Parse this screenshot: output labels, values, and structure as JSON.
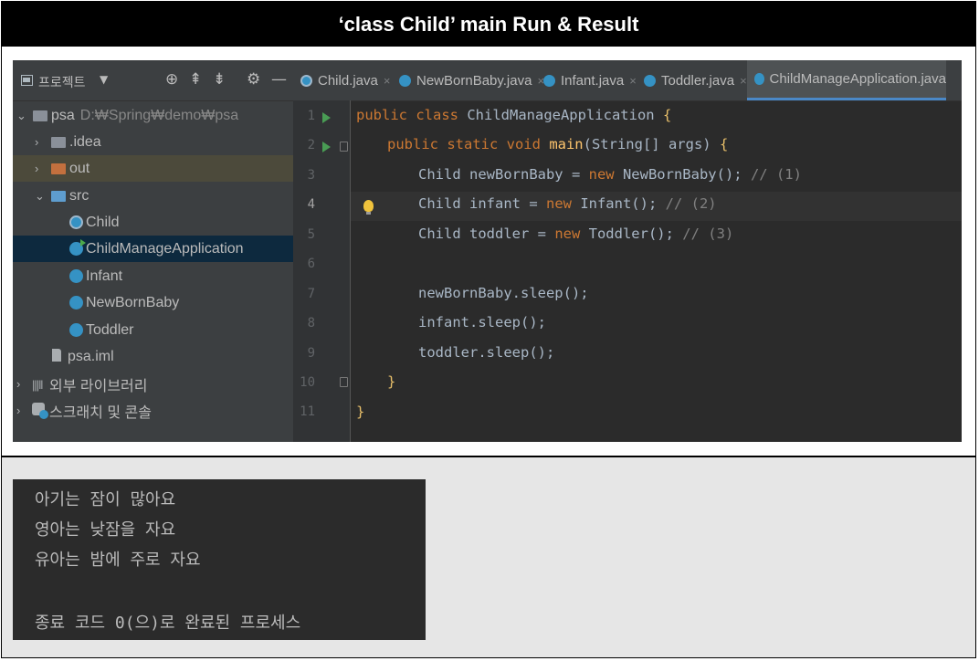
{
  "slide": {
    "title": "‘class Child’ main Run & Result"
  },
  "project_panel": {
    "title": "프로젝트",
    "caret": "▼",
    "tools": [
      "⊕",
      "⇞",
      "⇟",
      "⚙",
      "—"
    ],
    "root": {
      "name": "psa",
      "path": "D:₩Spring₩demo₩psa"
    },
    "items": [
      {
        "label": ".idea"
      },
      {
        "label": "out"
      },
      {
        "label": "src"
      },
      {
        "label": "Child"
      },
      {
        "label": "ChildManageApplication"
      },
      {
        "label": "Infant"
      },
      {
        "label": "NewBornBaby"
      },
      {
        "label": "Toddler"
      },
      {
        "label": "psa.iml"
      },
      {
        "label": "외부 라이브러리"
      },
      {
        "label": "스크래치 및 콘솔"
      }
    ]
  },
  "tabs": [
    {
      "label": "Child.java",
      "close": "×"
    },
    {
      "label": "NewBornBaby.java",
      "close": "×"
    },
    {
      "label": "Infant.java",
      "close": "×"
    },
    {
      "label": "Toddler.java",
      "close": "×"
    },
    {
      "label": "ChildManageApplication.java",
      "close": ""
    }
  ],
  "editor": {
    "line_numbers": [
      "1",
      "2",
      "3",
      "4",
      "5",
      "6",
      "7",
      "8",
      "9",
      "10",
      "11"
    ],
    "current_line": 4,
    "code": [
      {
        "kw": "public class ",
        "plain": "ChildManageApplication ",
        "br": "{"
      },
      {
        "kw": "public static void ",
        "fn": "main",
        "plain": "(String[] args) ",
        "br": "{"
      },
      {
        "plain": "Child newBornBaby = ",
        "kw": "new ",
        "plain2": "NewBornBaby();",
        "cm": " // (1)"
      },
      {
        "plain": "Child infant = ",
        "kw": "new ",
        "plain2": "Infant();",
        "cm": " // (2)"
      },
      {
        "plain": "Child toddler = ",
        "kw": "new ",
        "plain2": "Toddler();",
        "cm": " // (3)"
      },
      {
        "plain": ""
      },
      {
        "plain": "newBornBaby.sleep();"
      },
      {
        "plain": "infant.sleep();"
      },
      {
        "plain": "toddler.sleep();"
      },
      {
        "plain": "}"
      },
      {
        "plain": "}"
      }
    ]
  },
  "console": {
    "lines": [
      "아기는 잠이 많아요",
      "영아는 낮잠을 자요",
      "유아는 밤에 주로 자요",
      "",
      "종료 코드 0(으)로 완료된 프로세스"
    ]
  },
  "colors": {
    "title_bg": "#000000",
    "ide_bg": "#2b2b2b",
    "panel_bg": "#3c3f41",
    "selection": "#0d293e",
    "keyword": "#cc7832",
    "function": "#ffc66d",
    "comment": "#808080",
    "text": "#a9b7c6",
    "run_marker": "#499c54"
  }
}
